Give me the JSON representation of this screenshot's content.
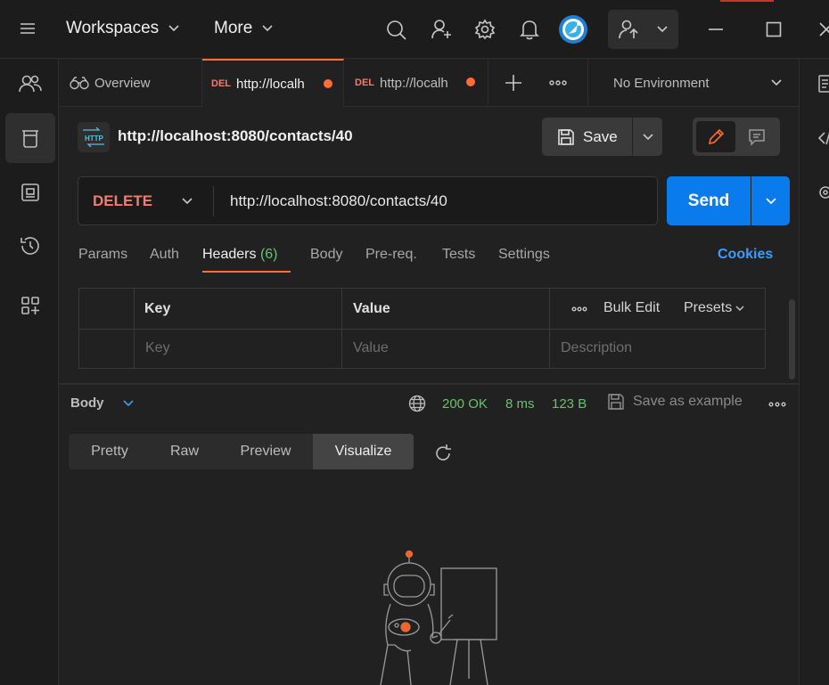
{
  "titlebar": {
    "workspaces_label": "Workspaces",
    "more_label": "More"
  },
  "tabs": {
    "overview_label": "Overview",
    "tab1": {
      "method": "DEL",
      "url": "http://localh"
    },
    "tab2": {
      "method": "DEL",
      "url": "http://localh"
    },
    "environment_label": "No Environment"
  },
  "request": {
    "title": "http://localhost:8080/contacts/40",
    "save_label": "Save",
    "method": "DELETE",
    "url": "http://localhost:8080/contacts/40",
    "send_label": "Send"
  },
  "request_tabs": {
    "params": "Params",
    "auth": "Auth",
    "headers": "Headers",
    "headers_count": "(6)",
    "body": "Body",
    "prereq": "Pre-req.",
    "tests": "Tests",
    "settings": "Settings",
    "cookies": "Cookies"
  },
  "headers_table": {
    "col_key": "Key",
    "col_value": "Value",
    "bulk_edit": "Bulk Edit",
    "presets": "Presets",
    "placeholder_key": "Key",
    "placeholder_value": "Value",
    "placeholder_description": "Description"
  },
  "response": {
    "body_label": "Body",
    "status": "200 OK",
    "time": "8 ms",
    "size": "123 B",
    "save_example": "Save as example",
    "views": [
      "Pretty",
      "Raw",
      "Preview",
      "Visualize"
    ],
    "active_view": "Visualize"
  },
  "colors": {
    "accent_orange": "#ff6c37",
    "send_blue": "#097bed",
    "status_green": "#6cc070",
    "method_delete": "#f47b6e"
  }
}
